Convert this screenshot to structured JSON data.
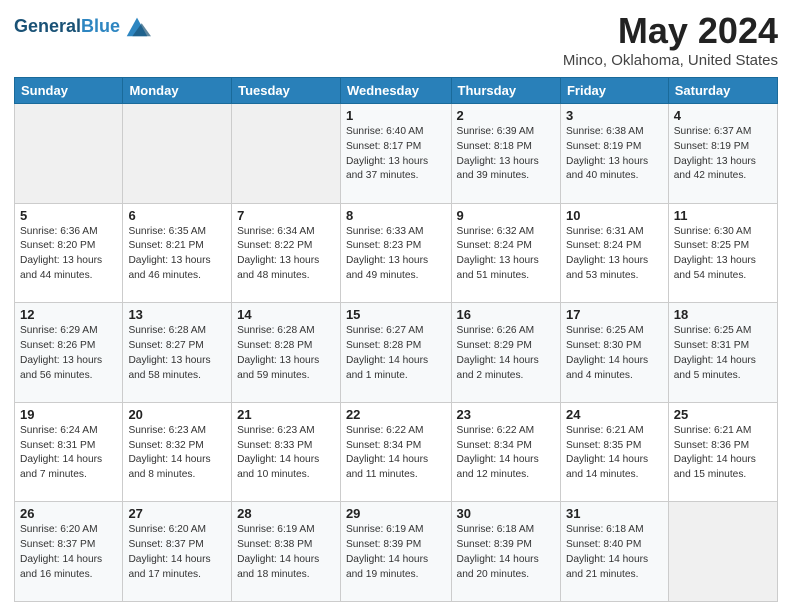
{
  "header": {
    "logo_line1": "General",
    "logo_line2": "Blue",
    "title": "May 2024",
    "subtitle": "Minco, Oklahoma, United States"
  },
  "days_of_week": [
    "Sunday",
    "Monday",
    "Tuesday",
    "Wednesday",
    "Thursday",
    "Friday",
    "Saturday"
  ],
  "weeks": [
    [
      {
        "day": "",
        "info": ""
      },
      {
        "day": "",
        "info": ""
      },
      {
        "day": "",
        "info": ""
      },
      {
        "day": "1",
        "info": "Sunrise: 6:40 AM\nSunset: 8:17 PM\nDaylight: 13 hours and 37 minutes."
      },
      {
        "day": "2",
        "info": "Sunrise: 6:39 AM\nSunset: 8:18 PM\nDaylight: 13 hours and 39 minutes."
      },
      {
        "day": "3",
        "info": "Sunrise: 6:38 AM\nSunset: 8:19 PM\nDaylight: 13 hours and 40 minutes."
      },
      {
        "day": "4",
        "info": "Sunrise: 6:37 AM\nSunset: 8:19 PM\nDaylight: 13 hours and 42 minutes."
      }
    ],
    [
      {
        "day": "5",
        "info": "Sunrise: 6:36 AM\nSunset: 8:20 PM\nDaylight: 13 hours and 44 minutes."
      },
      {
        "day": "6",
        "info": "Sunrise: 6:35 AM\nSunset: 8:21 PM\nDaylight: 13 hours and 46 minutes."
      },
      {
        "day": "7",
        "info": "Sunrise: 6:34 AM\nSunset: 8:22 PM\nDaylight: 13 hours and 48 minutes."
      },
      {
        "day": "8",
        "info": "Sunrise: 6:33 AM\nSunset: 8:23 PM\nDaylight: 13 hours and 49 minutes."
      },
      {
        "day": "9",
        "info": "Sunrise: 6:32 AM\nSunset: 8:24 PM\nDaylight: 13 hours and 51 minutes."
      },
      {
        "day": "10",
        "info": "Sunrise: 6:31 AM\nSunset: 8:24 PM\nDaylight: 13 hours and 53 minutes."
      },
      {
        "day": "11",
        "info": "Sunrise: 6:30 AM\nSunset: 8:25 PM\nDaylight: 13 hours and 54 minutes."
      }
    ],
    [
      {
        "day": "12",
        "info": "Sunrise: 6:29 AM\nSunset: 8:26 PM\nDaylight: 13 hours and 56 minutes."
      },
      {
        "day": "13",
        "info": "Sunrise: 6:28 AM\nSunset: 8:27 PM\nDaylight: 13 hours and 58 minutes."
      },
      {
        "day": "14",
        "info": "Sunrise: 6:28 AM\nSunset: 8:28 PM\nDaylight: 13 hours and 59 minutes."
      },
      {
        "day": "15",
        "info": "Sunrise: 6:27 AM\nSunset: 8:28 PM\nDaylight: 14 hours and 1 minute."
      },
      {
        "day": "16",
        "info": "Sunrise: 6:26 AM\nSunset: 8:29 PM\nDaylight: 14 hours and 2 minutes."
      },
      {
        "day": "17",
        "info": "Sunrise: 6:25 AM\nSunset: 8:30 PM\nDaylight: 14 hours and 4 minutes."
      },
      {
        "day": "18",
        "info": "Sunrise: 6:25 AM\nSunset: 8:31 PM\nDaylight: 14 hours and 5 minutes."
      }
    ],
    [
      {
        "day": "19",
        "info": "Sunrise: 6:24 AM\nSunset: 8:31 PM\nDaylight: 14 hours and 7 minutes."
      },
      {
        "day": "20",
        "info": "Sunrise: 6:23 AM\nSunset: 8:32 PM\nDaylight: 14 hours and 8 minutes."
      },
      {
        "day": "21",
        "info": "Sunrise: 6:23 AM\nSunset: 8:33 PM\nDaylight: 14 hours and 10 minutes."
      },
      {
        "day": "22",
        "info": "Sunrise: 6:22 AM\nSunset: 8:34 PM\nDaylight: 14 hours and 11 minutes."
      },
      {
        "day": "23",
        "info": "Sunrise: 6:22 AM\nSunset: 8:34 PM\nDaylight: 14 hours and 12 minutes."
      },
      {
        "day": "24",
        "info": "Sunrise: 6:21 AM\nSunset: 8:35 PM\nDaylight: 14 hours and 14 minutes."
      },
      {
        "day": "25",
        "info": "Sunrise: 6:21 AM\nSunset: 8:36 PM\nDaylight: 14 hours and 15 minutes."
      }
    ],
    [
      {
        "day": "26",
        "info": "Sunrise: 6:20 AM\nSunset: 8:37 PM\nDaylight: 14 hours and 16 minutes."
      },
      {
        "day": "27",
        "info": "Sunrise: 6:20 AM\nSunset: 8:37 PM\nDaylight: 14 hours and 17 minutes."
      },
      {
        "day": "28",
        "info": "Sunrise: 6:19 AM\nSunset: 8:38 PM\nDaylight: 14 hours and 18 minutes."
      },
      {
        "day": "29",
        "info": "Sunrise: 6:19 AM\nSunset: 8:39 PM\nDaylight: 14 hours and 19 minutes."
      },
      {
        "day": "30",
        "info": "Sunrise: 6:18 AM\nSunset: 8:39 PM\nDaylight: 14 hours and 20 minutes."
      },
      {
        "day": "31",
        "info": "Sunrise: 6:18 AM\nSunset: 8:40 PM\nDaylight: 14 hours and 21 minutes."
      },
      {
        "day": "",
        "info": ""
      }
    ]
  ]
}
